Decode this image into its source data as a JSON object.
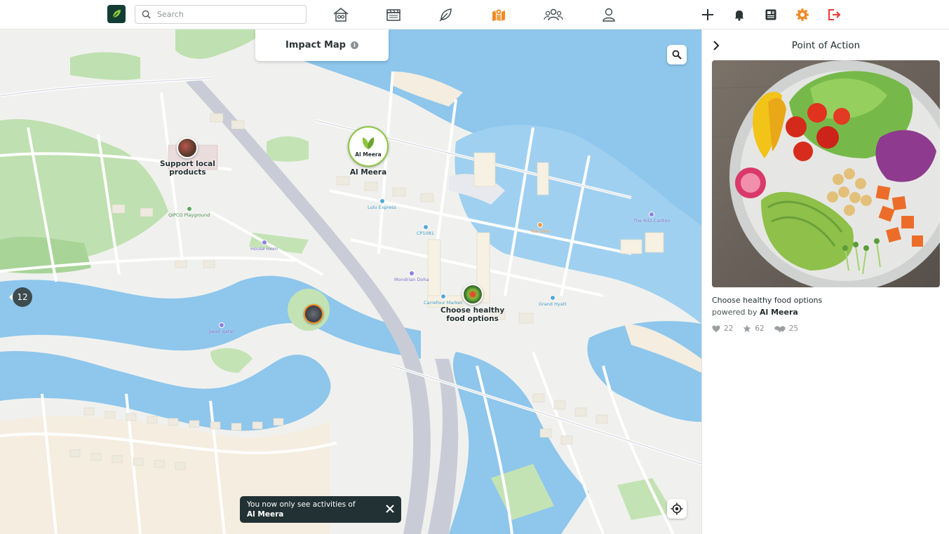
{
  "search": {
    "placeholder": "Search"
  },
  "nav": [
    {
      "icon": "home-icon"
    },
    {
      "icon": "clapperboard-icon"
    },
    {
      "icon": "leaf-icon"
    },
    {
      "icon": "map-icon",
      "active": true
    },
    {
      "icon": "community-icon"
    },
    {
      "icon": "profile-icon"
    }
  ],
  "actions": [
    {
      "icon": "plus-icon"
    },
    {
      "icon": "bell-icon"
    },
    {
      "icon": "news-icon"
    },
    {
      "icon": "gear-icon"
    },
    {
      "icon": "logout-icon"
    }
  ],
  "map": {
    "title": "Impact Map",
    "info": "i",
    "cluster_count": "12",
    "markers": [
      {
        "label": "Support local\nproducts"
      },
      {
        "label": "Al Meera",
        "logo_text": "Al Meera"
      },
      {
        "label": "Choose healthy\nfood options"
      }
    ],
    "pois": [
      "QIPCO Playground",
      "Lulu Express",
      "CP1081",
      "Tea time",
      "The Ritz-Carlton",
      "House room",
      "Mondrian Doha",
      "Carrefour Market",
      "Grand Hyatt",
      "pearl qatar"
    ],
    "toast": {
      "line1": "You now only see activities of",
      "line2": "Al Meera"
    }
  },
  "panel": {
    "title": "Point of Action",
    "activity_title": "Choose healthy food options",
    "powered_prefix": "powered by",
    "powered_by": "Al Meera",
    "stats": {
      "likes": "22",
      "stars": "62",
      "handshakes": "25"
    }
  },
  "colors": {
    "accent": "#f08a24",
    "brand": "#123d34",
    "logout": "#e53935",
    "water": "#8ec6ec"
  }
}
